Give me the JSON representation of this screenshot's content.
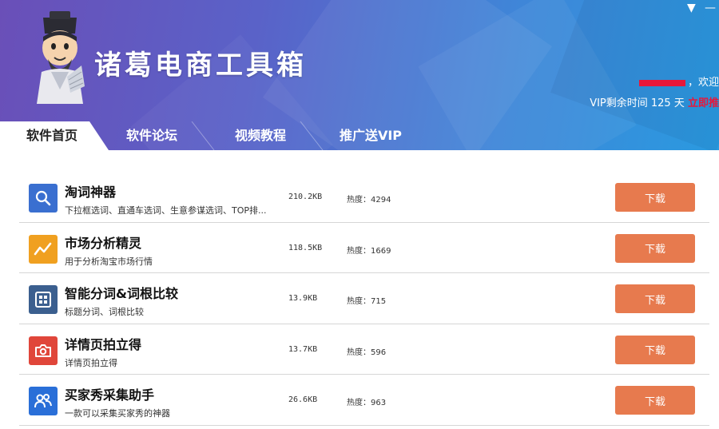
{
  "app": {
    "title": "诸葛电商工具箱",
    "greeting": "，欢迎",
    "vip_text": "VIP剩余时间 125 天",
    "vip_link": "立即推"
  },
  "window": {
    "menu_icon": "▼",
    "min_icon": "—"
  },
  "tabs": [
    {
      "label": "软件首页",
      "active": true
    },
    {
      "label": "软件论坛",
      "active": false
    },
    {
      "label": "视频教程",
      "active": false
    },
    {
      "label": "推广送VIP",
      "active": false
    }
  ],
  "heat_label": "热度：",
  "download_label": "下载",
  "tools": [
    {
      "name": "淘词神器",
      "desc": "下拉框选词、直通车选词、生意参谋选词、TOP排...",
      "size": "210.2KB",
      "heat": "4294",
      "icon": "search-icon",
      "icon_color": "#3a6fd0"
    },
    {
      "name": "市场分析精灵",
      "desc": "用于分析淘宝市场行情",
      "size": "118.5KB",
      "heat": "1669",
      "icon": "trend-chart-icon",
      "icon_color": "#f0a020"
    },
    {
      "name": "智能分词&词根比较",
      "desc": "标题分词、词根比较",
      "size": "13.9KB",
      "heat": "715",
      "icon": "grid-icon",
      "icon_color": "#3b5f8f"
    },
    {
      "name": "详情页拍立得",
      "desc": "详情页拍立得",
      "size": "13.7KB",
      "heat": "596",
      "icon": "camera-icon",
      "icon_color": "#e0463a"
    },
    {
      "name": "买家秀采集助手",
      "desc": "一款可以采集买家秀的神器",
      "size": "26.6KB",
      "heat": "963",
      "icon": "users-icon",
      "icon_color": "#2a6fd8"
    }
  ]
}
